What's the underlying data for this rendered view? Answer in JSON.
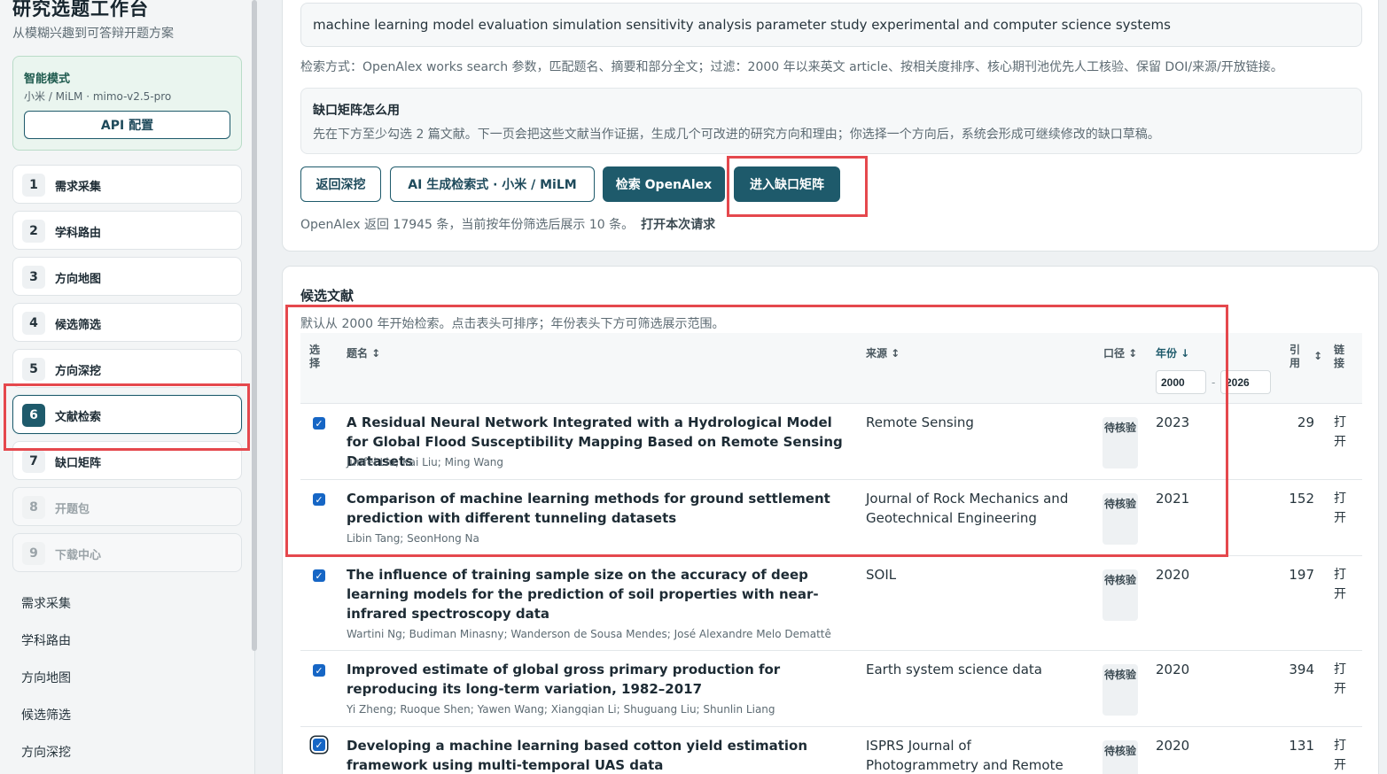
{
  "app": {
    "title": "研究选题工作台",
    "subtitle": "从模糊兴趣到可答辩开题方案"
  },
  "mode": {
    "title": "智能模式",
    "model": "小米 / MiLM · mimo-v2.5-pro",
    "api_button": "API 配置"
  },
  "steps": [
    {
      "num": "1",
      "label": "需求采集",
      "state": "normal"
    },
    {
      "num": "2",
      "label": "学科路由",
      "state": "normal"
    },
    {
      "num": "3",
      "label": "方向地图",
      "state": "normal"
    },
    {
      "num": "4",
      "label": "候选筛选",
      "state": "normal"
    },
    {
      "num": "5",
      "label": "方向深挖",
      "state": "normal"
    },
    {
      "num": "6",
      "label": "文献检索",
      "state": "active"
    },
    {
      "num": "7",
      "label": "缺口矩阵",
      "state": "normal"
    },
    {
      "num": "8",
      "label": "开题包",
      "state": "disabled"
    },
    {
      "num": "9",
      "label": "下载中心",
      "state": "disabled"
    }
  ],
  "nav_links": [
    "需求采集",
    "学科路由",
    "方向地图",
    "候选筛选",
    "方向深挖"
  ],
  "search": {
    "query": "machine learning model evaluation simulation sensitivity analysis parameter study experimental and computer science systems",
    "description": "检索方式：OpenAlex works search 参数，匹配题名、摘要和部分全文；过滤：2000 年以来英文 article、按相关度排序、核心期刊池优先人工核验、保留 DOI/来源/开放链接。",
    "help_title": "缺口矩阵怎么用",
    "help_text": "先在下方至少勾选 2 篇文献。下一页会把这些文献当作证据，生成几个可改进的研究方向和理由；你选择一个方向后，系统会形成可继续修改的缺口草稿。",
    "buttons": {
      "back": "返回深挖",
      "ai_generate": "AI 生成检索式 · 小米 / MiLM",
      "search_openalex": "检索 OpenAlex",
      "enter_matrix": "进入缺口矩阵"
    },
    "result_text": "OpenAlex 返回 17945 条，当前按年份筛选后展示 10 条。",
    "open_request": "打开本次请求"
  },
  "candidates": {
    "title": "候选文献",
    "description": "默认从 2000 年开始检索。点击表头可排序；年份表头下方可筛选展示范围。",
    "headers": {
      "select": "选择",
      "title": "题名 ↕",
      "source": "来源 ↕",
      "caliber": "口径 ↕",
      "year": "年份 ↓",
      "cites": "引用",
      "cites_sort": "↕",
      "link": "链接"
    },
    "year_from": "2000",
    "year_to": "2026",
    "year_dash": "-",
    "rows": [
      {
        "checked": true,
        "title": "A Residual Neural Network Integrated with a Hydrological Model for Global Flood Susceptibility Mapping Based on Remote Sensing Datasets",
        "authors": "Junfei Liu; Kai Liu; Ming Wang",
        "source": "Remote Sensing",
        "badge": "待核验",
        "year": "2023",
        "cites": "29",
        "link": "打开"
      },
      {
        "checked": true,
        "title": "Comparison of machine learning methods for ground settlement prediction with different tunneling datasets",
        "authors": "Libin Tang; SeonHong Na",
        "source": "Journal of Rock Mechanics and Geotechnical Engineering",
        "badge": "待核验",
        "year": "2021",
        "cites": "152",
        "link": "打开"
      },
      {
        "checked": true,
        "title": "The influence of training sample size on the accuracy of deep learning models for the prediction of soil properties with near-infrared spectroscopy data",
        "authors": "Wartini Ng; Budiman Minasny; Wanderson de Sousa Mendes; José Alexandre Melo Demattê",
        "source": "SOIL",
        "badge": "待核验",
        "year": "2020",
        "cites": "197",
        "link": "打开"
      },
      {
        "checked": true,
        "title": "Improved estimate of global gross primary production for reproducing its long-term variation, 1982–2017",
        "authors": "Yi Zheng; Ruoque Shen; Yawen Wang; Xiangqian Li; Shuguang Liu; Shunlin Liang",
        "source": "Earth system science data",
        "badge": "待核验",
        "year": "2020",
        "cites": "394",
        "link": "打开"
      },
      {
        "checked": true,
        "title": "Developing a machine learning based cotton yield estimation framework using multi-temporal UAS data",
        "authors": "",
        "source": "ISPRS Journal of Photogrammetry and Remote Sensing",
        "badge": "待核验",
        "year": "2020",
        "cites": "131",
        "link": "打开"
      }
    ]
  },
  "colors": {
    "accent": "#1e5a6b",
    "highlight": "#e5484d",
    "checkbox": "#1666c5"
  }
}
